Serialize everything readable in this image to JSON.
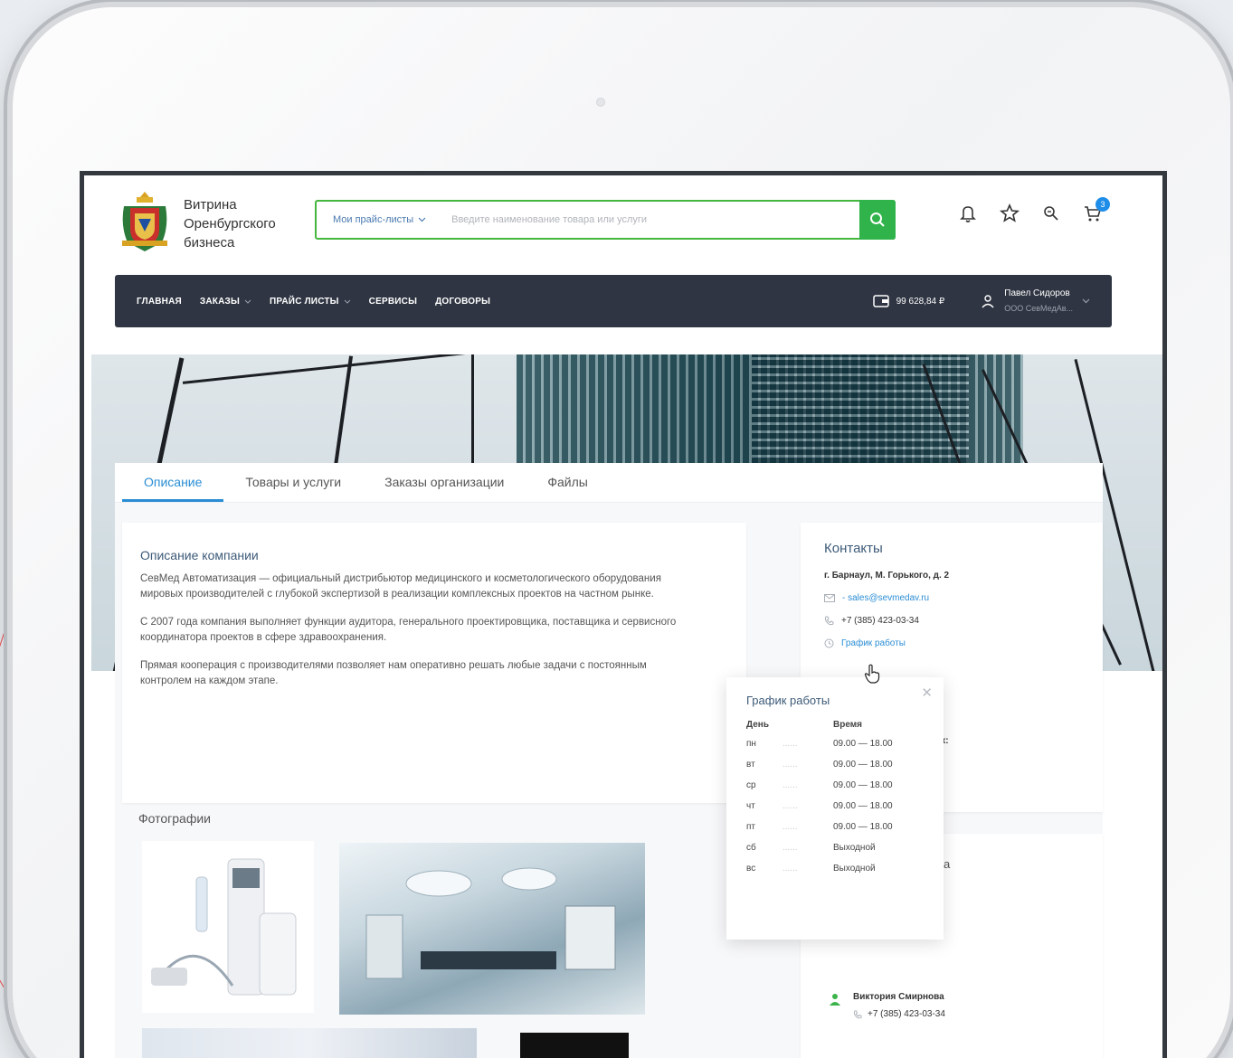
{
  "brand": {
    "name": "Витрина Оренбургского бизнеса"
  },
  "search": {
    "select_label": "Мои прайс-листы",
    "placeholder": "Введите наименование товара или услуги"
  },
  "header": {
    "cart_count": "3"
  },
  "nav": {
    "items": [
      {
        "label": "ГЛАВНАЯ",
        "dropdown": false
      },
      {
        "label": "ЗАКАЗЫ",
        "dropdown": true
      },
      {
        "label": "ПРАЙС ЛИСТЫ",
        "dropdown": true
      },
      {
        "label": "СЕРВИСЫ",
        "dropdown": false
      },
      {
        "label": "ДОГОВОРЫ",
        "dropdown": false
      }
    ],
    "balance": "99 628,84 ₽",
    "user_name": "Павел Сидоров",
    "user_org": "ООО СевМедАв..."
  },
  "tabs": [
    "Описание",
    "Товары и услуги",
    "Заказы организации",
    "Файлы"
  ],
  "description": {
    "title": "Описание компании",
    "paragraphs": [
      "СевМед Автоматизация — официальный дистрибьютор медицинского и косметологического оборудования мировых производителей с глубокой экспертизой в реализации комплексных проектов на частном рынке.",
      "С 2007 года компания выполняет функции аудитора, генерального проектировщика, поставщика и сервисного координатора проектов в сфере здравоохранения.",
      "Прямая кооперация с производителями позволяет нам оперативно решать любые задачи с постоянным контролем на каждом этапе."
    ]
  },
  "photos": {
    "title": "Фотографии"
  },
  "contacts": {
    "title": "Контакты",
    "address": "г. Барнаул, М. Горького, д. 2",
    "email": "- sales@sevmedav.ru",
    "phone": "+7 (385) 423-03-34",
    "schedule_link": "График работы",
    "partial_label": "тях:",
    "partial_letter": "а"
  },
  "manager": {
    "name": "Виктория Смирнова",
    "phone": "+7 (385) 423-03-34"
  },
  "schedule_popup": {
    "title": "График работы",
    "col_day": "День",
    "col_time": "Время",
    "rows": [
      {
        "day": "пн",
        "time": "09.00 — 18.00"
      },
      {
        "day": "вт",
        "time": "09.00 — 18.00"
      },
      {
        "day": "ср",
        "time": "09.00 — 18.00"
      },
      {
        "day": "чт",
        "time": "09.00 — 18.00"
      },
      {
        "day": "пт",
        "time": "09.00 — 18.00"
      },
      {
        "day": "сб",
        "time": "Выходной"
      },
      {
        "day": "вс",
        "time": "Выходной"
      }
    ]
  },
  "colors": {
    "accent_green": "#2fb34a",
    "nav_bg": "#2f3542",
    "link_blue": "#2a8dd4",
    "badge_blue": "#1f8ee8"
  }
}
